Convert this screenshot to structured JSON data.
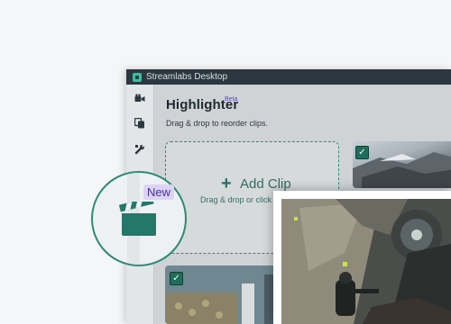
{
  "window": {
    "title": "Streamlabs Desktop"
  },
  "nav": [
    {
      "name": "video-camera-icon"
    },
    {
      "name": "copy-icon"
    },
    {
      "name": "wrench-icon"
    }
  ],
  "page": {
    "title": "Highlighter",
    "badge": "Beta",
    "subtitle": "Drag & drop to reorder clips."
  },
  "add_clip": {
    "label": "Add Clip",
    "hint": "Drag & drop or click to"
  },
  "callout": {
    "badge": "New",
    "icon": "clapperboard-icon"
  },
  "colors": {
    "accent": "#2e8b77",
    "titlebar": "#2b383f",
    "badge_bg": "#dcd3f7",
    "badge_text": "#43348f",
    "beta": "#5a46c8"
  }
}
